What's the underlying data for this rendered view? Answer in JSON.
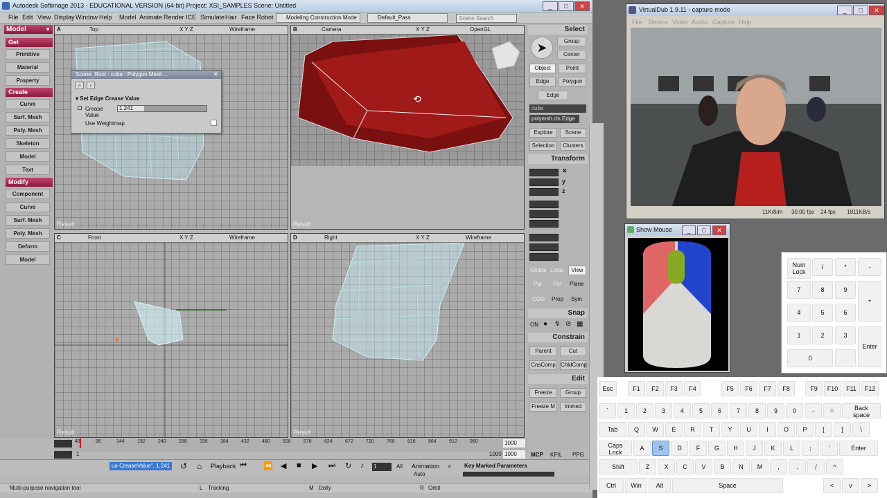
{
  "softimage": {
    "title": "Autodesk Softimage 2013 - EDUCATIONAL VERSION (64-bit)     Project: XSI_SAMPLES     Scene: Untitled",
    "menu": [
      "File",
      "Edit",
      "View",
      "Display",
      "Window",
      "Help",
      "Model",
      "Animate",
      "Render",
      "ICE",
      "Simulate",
      "Hair",
      "Face Robot"
    ],
    "layout_dropdown": "Modeling Construction Mode",
    "pass_dropdown": "Default_Pass",
    "scene_search_placeholder": "Scene Search",
    "left_panel": {
      "mode": "Model",
      "sections": [
        {
          "header": "Get",
          "items": [
            "Primitive",
            "Material",
            "Property"
          ]
        },
        {
          "header": "Create",
          "items": [
            "Curve",
            "Surf. Mesh",
            "Poly. Mesh",
            "Skeleton",
            "Model",
            "Text"
          ]
        },
        {
          "header": "Modify",
          "items": [
            "Component",
            "Curve",
            "Surf. Mesh",
            "Poly. Mesh",
            "Deform",
            "Model"
          ]
        }
      ]
    },
    "viewports": [
      {
        "letter": "A",
        "camera": "Top",
        "xyz": "X Y Z",
        "mode": "Wireframe",
        "result": "Result"
      },
      {
        "letter": "B",
        "camera": "Camera",
        "xyz": "X Y Z",
        "mode": "OpenGL",
        "result": "Result"
      },
      {
        "letter": "C",
        "camera": "Front",
        "xyz": "X Y Z",
        "mode": "Wireframe",
        "result": "Result"
      },
      {
        "letter": "D",
        "camera": "Right",
        "xyz": "X Y Z",
        "mode": "Wireframe",
        "result": "Result"
      }
    ],
    "dialog": {
      "title": "Scene_Root : cube : Polygon Mesh ...",
      "section": "Set Edge Crease Value",
      "crease_label": "Crease",
      "value_label": "Value",
      "crease_value": "1.241",
      "weightmap_label": "Use Weightmap"
    },
    "right_panel": {
      "select_header": "Select",
      "group": "Group",
      "center": "Center",
      "object": "Object",
      "point": "Point",
      "edge": "Edge",
      "polygon": "Polygon",
      "edge2": "Edge",
      "cube_field": "cube",
      "cluster_field": "polymsh.cls.Edge",
      "explore": "Explore",
      "scene": "Scene",
      "selection": "Selection",
      "clusters": "Clusters",
      "transform_header": "Transform",
      "axes": [
        "x",
        "y",
        "z"
      ],
      "ref_global": "Global",
      "ref_local": "Local",
      "ref_view": "View",
      "ref_par": "Par",
      "ref_ref": "Ref",
      "ref_plane": "Plane",
      "cog": "COG",
      "prop": "Prop",
      "sym": "Sym",
      "snap_header": "Snap",
      "snap_on": "ON",
      "constrain_header": "Constrain",
      "parent": "Parent",
      "cut": "Cut",
      "cnscomp": "CnsComp",
      "chldcomp": "ChldComp",
      "edit_header": "Edit",
      "freeze": "Freeze",
      "group2": "Group",
      "freeze_m": "Freeze M",
      "immed": "Immed",
      "tabs": [
        "MCP",
        "KP/L",
        "PPG"
      ]
    },
    "timeline": {
      "ticks": [
        "48",
        "96",
        "144",
        "192",
        "240",
        "288",
        "336",
        "384",
        "432",
        "480",
        "528",
        "576",
        "624",
        "672",
        "720",
        "768",
        "816",
        "864",
        "912",
        "960"
      ],
      "start": "1",
      "end": "1000",
      "end2": "1000",
      "field2": "1000"
    },
    "playbar": {
      "command": "ue CreaseValue\", 1.241",
      "playback": "Playback",
      "frame": "1",
      "all": "All",
      "animation": "Animation",
      "auto": "Auto",
      "key_marked": "Key Marked Parameters"
    },
    "status": {
      "message": "Multi-purpose navigation tool",
      "l": "L",
      "l_text": "Tracking",
      "m": "M",
      "m_text": "Dolly",
      "r": "R",
      "r_text": "Orbit"
    }
  },
  "virtualdub": {
    "title": "VirtualDub 1.9.11 - capture mode",
    "menu": [
      "File",
      "Device",
      "Video",
      "Audio",
      "Capture",
      "Help"
    ],
    "status": [
      "11K/8/m",
      "30.00 fps",
      "24 fps",
      "1811KB/s"
    ]
  },
  "show_mouse": {
    "title": "Show Mouse",
    "colors": {
      "left": "#e06666",
      "right": "#2244cc",
      "wheel": "#88aa22"
    }
  },
  "keyboard": {
    "fkeys": [
      "Esc",
      "F1",
      "F2",
      "F3",
      "F4",
      "F5",
      "F6",
      "F7",
      "F8",
      "F9",
      "F10",
      "F11",
      "F12"
    ],
    "row1": [
      "`",
      "1",
      "2",
      "3",
      "4",
      "5",
      "6",
      "7",
      "8",
      "9",
      "0",
      "-",
      "=",
      "Back space"
    ],
    "row2": [
      "Tab",
      "Q",
      "W",
      "E",
      "R",
      "T",
      "Y",
      "U",
      "I",
      "O",
      "P",
      "[",
      "]",
      "\\"
    ],
    "row3": [
      "Caps Lock",
      "A",
      "S",
      "D",
      "F",
      "G",
      "H",
      "J",
      "K",
      "L",
      ";",
      "'",
      "Enter"
    ],
    "row4": [
      "Shift",
      "Z",
      "X",
      "C",
      "V",
      "B",
      "N",
      "M",
      ",",
      ".",
      "/",
      "^"
    ],
    "row5": [
      "Ctrl",
      "Win",
      "Alt",
      "Space",
      "<",
      "v",
      ">"
    ],
    "highlighted": "S",
    "numpad": [
      "Num Lock",
      "/",
      "*",
      "-",
      "7",
      "8",
      "9",
      "+",
      "4",
      "5",
      "6",
      "1",
      "2",
      "3",
      "Enter",
      "0",
      "."
    ]
  }
}
